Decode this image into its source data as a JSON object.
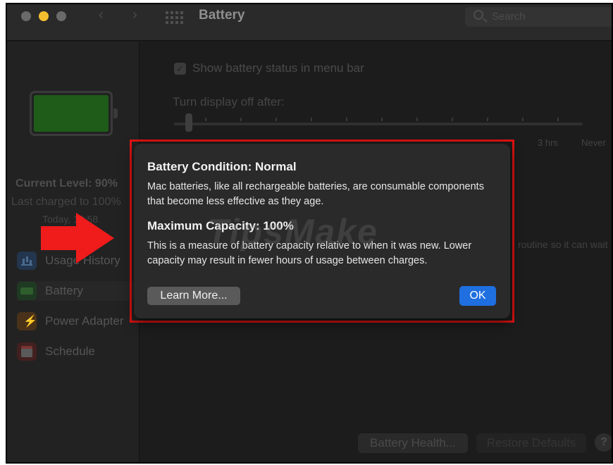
{
  "window": {
    "title": "Battery",
    "search_placeholder": "Search"
  },
  "sidebar": {
    "current_level": "Current Level: 90%",
    "last_charged": "Last charged to 100%",
    "charged_time": "Today, 10:58",
    "items": [
      {
        "label": "Usage History",
        "icon": "chart-icon"
      },
      {
        "label": "Battery",
        "icon": "battery-icon"
      },
      {
        "label": "Power Adapter",
        "icon": "power-icon"
      },
      {
        "label": "Schedule",
        "icon": "calendar-icon"
      }
    ]
  },
  "main": {
    "show_status_label": "Show battery status in menu bar",
    "show_status_checked": true,
    "turn_off_label": "Turn display off after:",
    "slider_labels": [
      "3 hrs",
      "Never"
    ],
    "partial_text": "routine so it can wait",
    "battery_health_button": "Battery Health...",
    "restore_defaults_button": "Restore Defaults",
    "help_button": "?"
  },
  "dialog": {
    "title1": "Battery Condition: Normal",
    "text1": "Mac batteries, like all rechargeable batteries, are consumable components that become less effective as they age.",
    "title2": "Maximum Capacity: 100%",
    "text2": "This is a measure of battery capacity relative to when it was new. Lower capacity may result in fewer hours of usage between charges.",
    "learn_more_button": "Learn More...",
    "ok_button": "OK",
    "watermark": "TipsMake"
  },
  "colors": {
    "annotation_red": "#e01212",
    "ok_blue": "#1f6fe0",
    "traffic_yellow": "#f4bf2f"
  }
}
